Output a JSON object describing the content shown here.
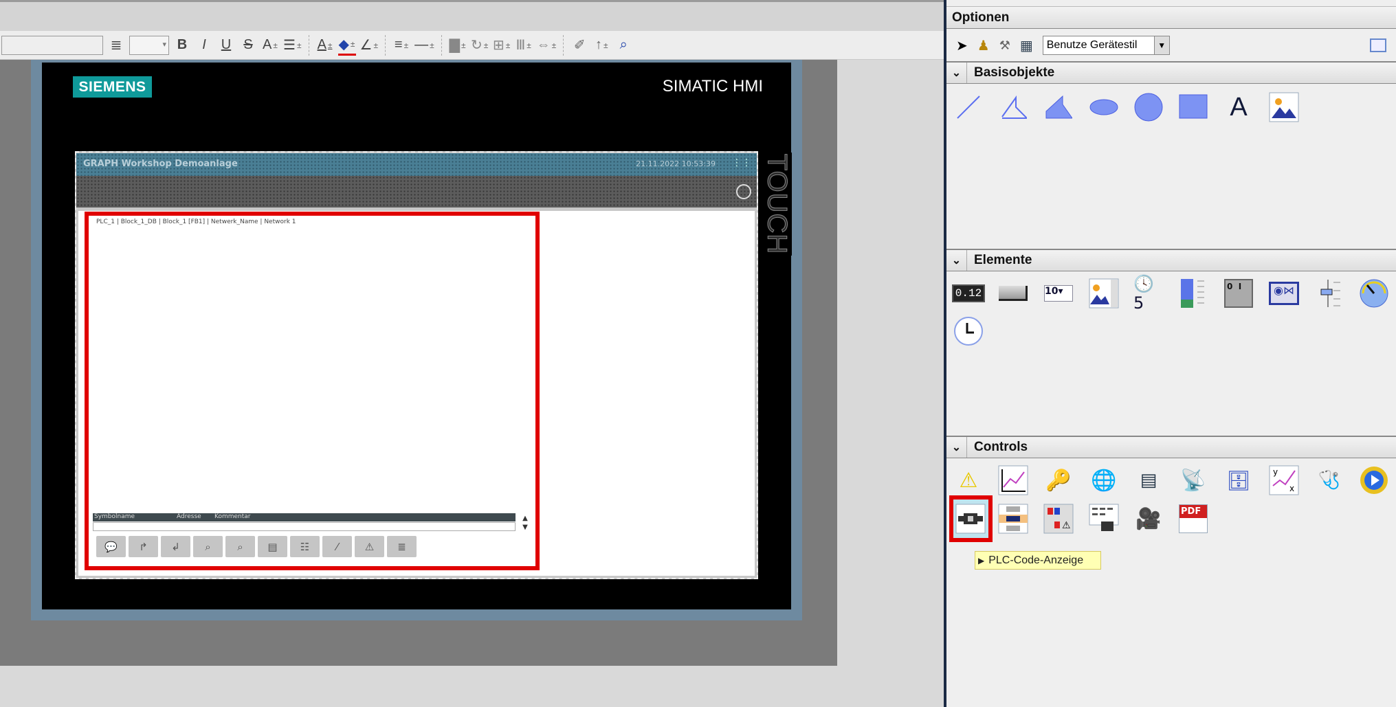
{
  "toolbar": {
    "items": [
      "text-field",
      "font-size",
      "bold",
      "italic",
      "underline",
      "strikethrough",
      "font-size-increase",
      "align",
      "font-color",
      "fill-color",
      "line-color",
      "line-width",
      "line-style",
      "arrange",
      "rotate",
      "align-objects",
      "distribute",
      "same-size",
      "format-painter",
      "text-direction",
      "zoom-selection"
    ],
    "bold": "B",
    "italic": "I",
    "underline": "U",
    "strike": "S",
    "fontgrow": "A",
    "fontcolor": "A"
  },
  "hmi": {
    "brand": "SIEMENS",
    "model": "SIMATIC HMI",
    "touch": "TOUCH",
    "screen_title": "GRAPH Workshop Demoanlage",
    "datetime": "21.11.2022 10:53:39",
    "breadcrumb": "PLC_1 | Block_1_DB | Block_1 [FB1] | Netwerk_Name | Network 1",
    "table_headers": [
      "Symbolname",
      "Adresse",
      "Kommentar"
    ],
    "buttons": [
      "comment",
      "jump-to",
      "jump-back",
      "zoom-in",
      "zoom-out",
      "block-monitor",
      "search-list",
      "add-network",
      "status-error",
      "list-view"
    ]
  },
  "colors": {
    "highlight": "#e00000",
    "brand": "#0f9a9a",
    "header": "#4a7f95"
  },
  "panel": {
    "title": "Optionen",
    "style_select": "Benutze Gerätestil",
    "sections": [
      {
        "label": "Basisobjekte",
        "items": [
          "line",
          "polyline",
          "polygon",
          "ellipse",
          "circle",
          "rectangle",
          "text-field",
          "graphic-view"
        ]
      },
      {
        "label": "Elemente",
        "items": [
          "io-field",
          "button",
          "symbolic-io-field",
          "graphic-io-field",
          "date-time-field",
          "bar",
          "switch",
          "symbol-library",
          "slider",
          "gauge",
          "clock"
        ]
      },
      {
        "label": "Controls",
        "items": [
          "alarm-view",
          "trend-view",
          "user-view",
          "html-browser",
          "recipe-view",
          "sm-at-view",
          "media-player",
          "f-x-trend",
          "system-diagnostics",
          "media-player-2",
          "plc-code-view",
          "protodiag-view",
          "criteria-analysis",
          "prodiag-overview",
          "camera-control",
          "pdf-view"
        ]
      }
    ],
    "tooltip": "PLC-Code-Anzeige"
  }
}
